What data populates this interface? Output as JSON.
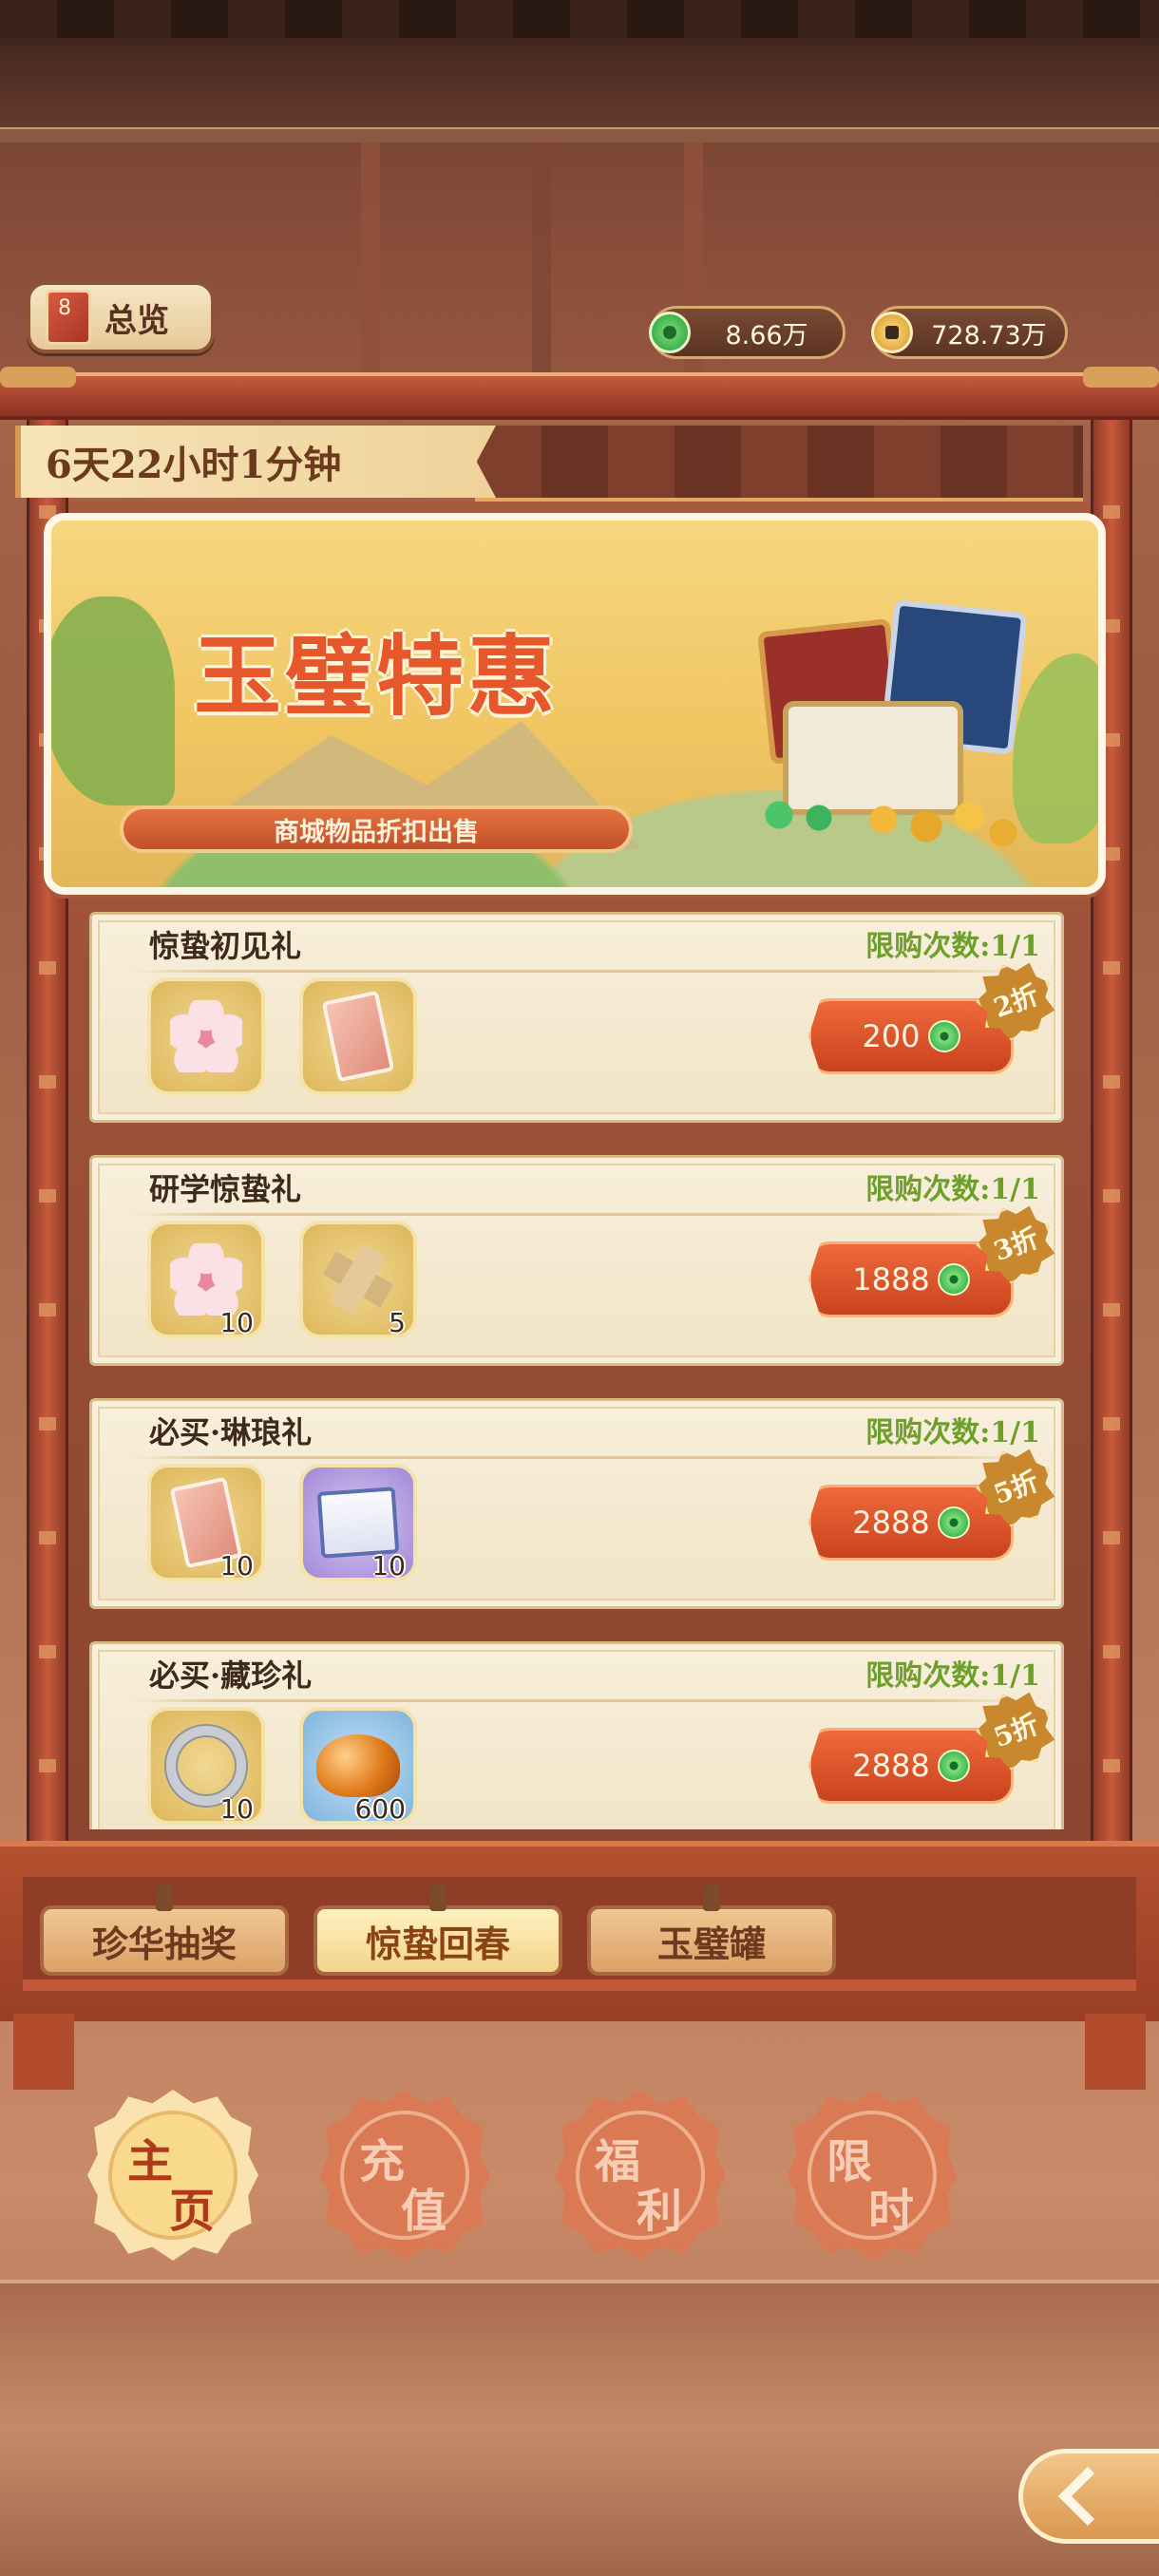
{
  "header": {
    "overview_label": "总览",
    "currencies": [
      {
        "name": "jade",
        "amount": "8.66万"
      },
      {
        "name": "gold",
        "amount": "728.73万"
      }
    ]
  },
  "timer": "6天22小时1分钟",
  "banner": {
    "title": "玉璧特惠",
    "subtitle": "商城物品折扣出售"
  },
  "packs": [
    {
      "title": "惊蛰初见礼",
      "limit": "限购次数:1/1",
      "price": "200",
      "discount": "2折",
      "items": [
        {
          "icon": "cherry-blossom-icon",
          "qty": ""
        },
        {
          "icon": "red-ticket-icon",
          "qty": ""
        }
      ]
    },
    {
      "title": "研学惊蛰礼",
      "limit": "限购次数:1/1",
      "price": "1888",
      "discount": "3折",
      "items": [
        {
          "icon": "cherry-blossom-icon",
          "qty": "10"
        },
        {
          "icon": "puzzle-piece-icon",
          "qty": "5"
        }
      ]
    },
    {
      "title": "必买·琳琅礼",
      "limit": "限购次数:1/1",
      "price": "2888",
      "discount": "5折",
      "items": [
        {
          "icon": "red-ticket-icon",
          "qty": "10"
        },
        {
          "icon": "scroll-icon",
          "qty": "10"
        }
      ]
    },
    {
      "title": "必买·藏珍礼",
      "limit": "限购次数:1/1",
      "price": "2888",
      "discount": "5折",
      "items": [
        {
          "icon": "silver-ring-icon",
          "qty": "10"
        },
        {
          "icon": "amber-stone-icon",
          "qty": "600"
        }
      ]
    }
  ],
  "tabs": [
    {
      "label": "珍华抽奖",
      "active": false
    },
    {
      "label": "惊蛰回春",
      "active": true
    },
    {
      "label": "玉璧罐",
      "active": false
    }
  ],
  "nav": [
    {
      "c1": "主",
      "c2": "页",
      "active": true
    },
    {
      "c1": "充",
      "c2": "值",
      "active": false
    },
    {
      "c1": "福",
      "c2": "利",
      "active": false
    },
    {
      "c1": "限",
      "c2": "时",
      "active": false
    }
  ],
  "colors": {
    "accent_orange": "#e6572b",
    "limit_green": "#6e9f2c",
    "frame_red": "#c55a3a"
  }
}
